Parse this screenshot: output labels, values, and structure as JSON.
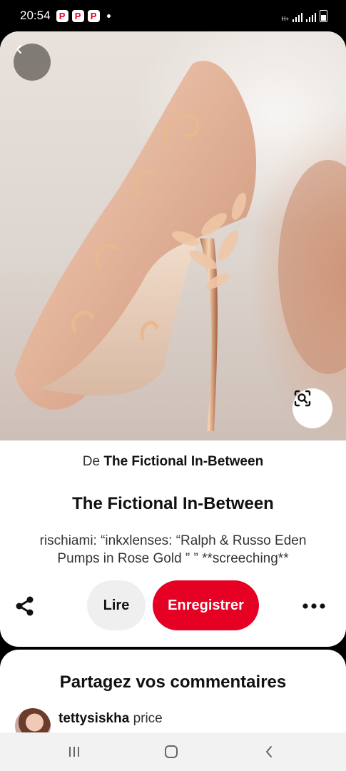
{
  "status_bar": {
    "time": "20:54",
    "app_icons": [
      "P",
      "P",
      "P"
    ],
    "network": "H+"
  },
  "pin": {
    "image_icon": "rose-gold-heel-photo",
    "source_prefix": "De",
    "source_name": "The Fictional In-Between",
    "title": "The Fictional In-Between",
    "description": "rischiami: “inkxlenses: “Ralph & Russo Eden Pumps in Rose Gold ” ” **screeching**"
  },
  "actions": {
    "read_label": "Lire",
    "save_label": "Enregistrer",
    "save_color": "#e60023"
  },
  "comments": {
    "title": "Partagez vos commentaires",
    "first": {
      "user": "tettysiskha",
      "text": "price"
    }
  }
}
